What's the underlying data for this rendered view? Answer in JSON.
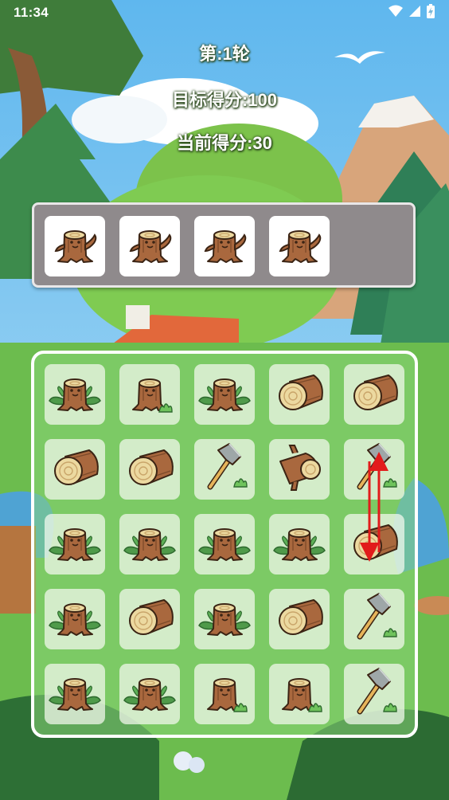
{
  "status_bar": {
    "time": "11:34",
    "icons": [
      "wifi-icon",
      "cellular-signal-icon",
      "battery-icon"
    ]
  },
  "hud": {
    "round": "第:1轮",
    "target": "目标得分:100",
    "score": "当前得分:30"
  },
  "tray": {
    "slots": [
      "stump",
      "stump",
      "stump",
      "stump"
    ]
  },
  "board": {
    "rows": [
      [
        "stump-leaves",
        "stump-grass",
        "stump-leaves",
        "log",
        "log"
      ],
      [
        "log",
        "log",
        "axe",
        "log-branch",
        "axe"
      ],
      [
        "stump-leaves",
        "stump-leaves",
        "stump-leaves",
        "stump-leaves",
        "log"
      ],
      [
        "stump-leaves",
        "log",
        "stump-leaves",
        "log",
        "axe"
      ],
      [
        "stump-leaves",
        "stump-leaves",
        "stump-grass",
        "stump-grass",
        "axe"
      ]
    ]
  },
  "hint": {
    "swap": [
      [
        1,
        4
      ],
      [
        2,
        4
      ]
    ],
    "color": "#e21b1b"
  },
  "colors": {
    "wood": "#a9683e",
    "wood_dark": "#3b2414",
    "log_end": "#ecd9a0",
    "leaf": "#4f9a4a",
    "tray": "#8f8a8c"
  }
}
